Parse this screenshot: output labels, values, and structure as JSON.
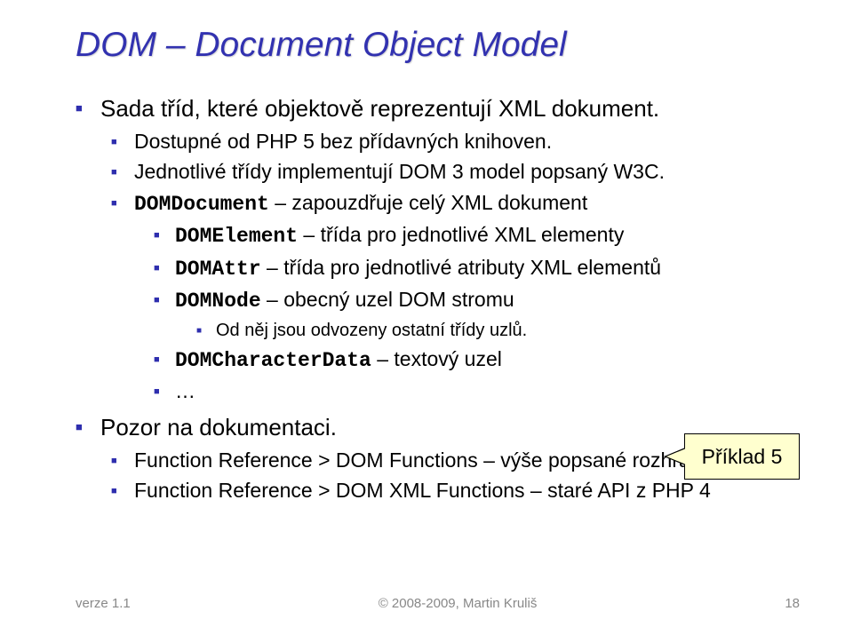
{
  "title": "DOM – Document Object Model",
  "bullets": {
    "l1a": "Sada tříd, které objektově reprezentují XML dokument.",
    "l2a": "Dostupné od PHP 5 bez přídavných knihoven.",
    "l2b": "Jednotlivé třídy implementují DOM 3 model popsaný W3C.",
    "l2c_code": "DOMDocument",
    "l2c_text": " – zapouzdřuje celý XML dokument",
    "l3a_code": "DOMElement",
    "l3a_text": " – třída pro jednotlivé XML elementy",
    "l3b_code": "DOMAttr",
    "l3b_text": " – třída pro jednotlivé atributy XML elementů",
    "l3c_code": "DOMNode",
    "l3c_text": " – obecný uzel DOM stromu",
    "l4a": "Od něj jsou odvozeny ostatní třídy uzlů.",
    "l3d_code": "DOMCharacterData",
    "l3d_text": " – textový uzel",
    "l3e": "…",
    "l1b": "Pozor na dokumentaci.",
    "l2d": "Function Reference > DOM Functions – výše popsané rozhraní",
    "l2e": "Function Reference > DOM XML Functions – staré API z PHP 4"
  },
  "callout": "Příklad 5",
  "footer": {
    "left": "verze 1.1",
    "center": "© 2008-2009, Martin Kruliš",
    "page": "18"
  }
}
